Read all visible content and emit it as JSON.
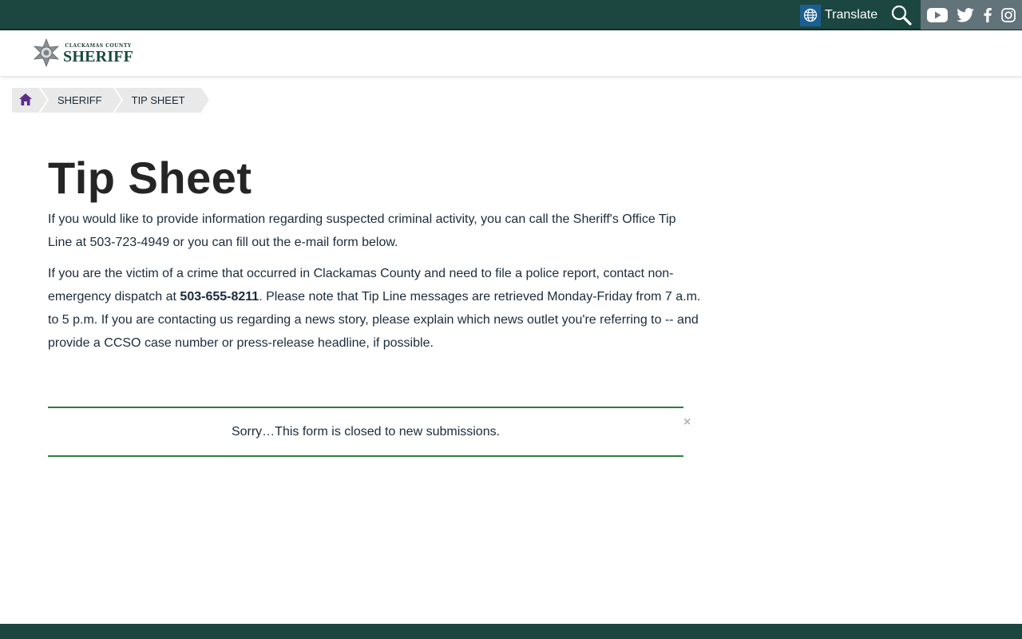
{
  "topbar": {
    "translate_label": "Translate",
    "search_icon": "search-icon",
    "social_icons": [
      "youtube-icon",
      "twitter-icon",
      "facebook-icon",
      "instagram-icon"
    ]
  },
  "header": {
    "logo_county": "CLACKAMAS COUNTY",
    "logo_name": "SHERIFF"
  },
  "breadcrumb": {
    "home_icon": "home-icon",
    "items": [
      "SHERIFF",
      "TIP SHEET"
    ]
  },
  "main": {
    "title": "Tip Sheet",
    "paragraph1": "If you would like to provide information regarding suspected criminal activity, you can call the Sheriff's Office Tip Line at 503-723-4949 or you can fill out the e-mail form below.",
    "paragraph2_before": "If you are the victim of a crime that occurred in Clackamas County and need to file a police report, contact non-emergency dispatch at ",
    "paragraph2_phone": "503-655-8211",
    "paragraph2_after": ". Please note that Tip Line messages are retrieved Monday-Friday from 7 a.m. to 5 p.m. If you are contacting us regarding a news story, please explain which news outlet you're referring to -- and provide a CCSO case number or press-release headline, if possible."
  },
  "notice": {
    "text": "Sorry…This form is closed to new submissions.",
    "close": "×"
  },
  "colors": {
    "topbar": "#1c4741",
    "social_bg": "#62737a",
    "translate_globe": "#1a5f93",
    "accent_green": "#2e7d3e",
    "text": "#1c2b3a"
  }
}
